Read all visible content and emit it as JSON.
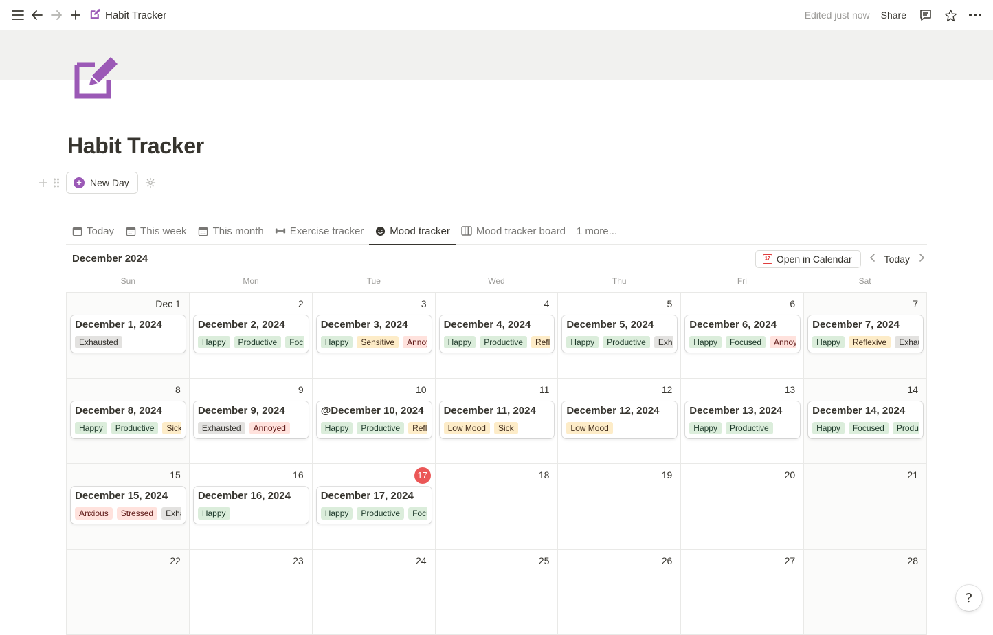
{
  "topbar": {
    "title": "Habit Tracker",
    "edited": "Edited just now",
    "share": "Share"
  },
  "page": {
    "title": "Habit Tracker",
    "new_day": "New Day",
    "icon_color": "#9b59b6"
  },
  "tabs": [
    {
      "label": "Today",
      "icon": "calendar-icon"
    },
    {
      "label": "This week",
      "icon": "calendar-grid-icon"
    },
    {
      "label": "This month",
      "icon": "calendar-grid-icon"
    },
    {
      "label": "Exercise tracker",
      "icon": "dumbbell-icon"
    },
    {
      "label": "Mood tracker",
      "icon": "smiley-icon",
      "active": true
    },
    {
      "label": "Mood tracker board",
      "icon": "board-icon"
    },
    {
      "label": "1 more...",
      "icon": ""
    }
  ],
  "calendar": {
    "month": "December 2024",
    "open_in_calendar": "Open in Calendar",
    "today": "Today",
    "weekdays": [
      "Sun",
      "Mon",
      "Tue",
      "Wed",
      "Thu",
      "Fri",
      "Sat"
    ],
    "today_date": "17",
    "days": [
      {
        "num": "Dec 1",
        "title": "December 1, 2024",
        "tags": [
          [
            "Exhausted",
            "gray"
          ]
        ]
      },
      {
        "num": "2",
        "title": "December 2, 2024",
        "tags": [
          [
            "Happy",
            "green"
          ],
          [
            "Productive",
            "green"
          ],
          [
            "Focused",
            "green"
          ]
        ]
      },
      {
        "num": "3",
        "title": "December 3, 2024",
        "tags": [
          [
            "Happy",
            "green"
          ],
          [
            "Sensitive",
            "orange"
          ],
          [
            "Annoyed",
            "red"
          ]
        ]
      },
      {
        "num": "4",
        "title": "December 4, 2024",
        "tags": [
          [
            "Happy",
            "green"
          ],
          [
            "Productive",
            "green"
          ],
          [
            "Reflexive",
            "orange"
          ]
        ]
      },
      {
        "num": "5",
        "title": "December 5, 2024",
        "tags": [
          [
            "Happy",
            "green"
          ],
          [
            "Productive",
            "green"
          ],
          [
            "Exhausted",
            "gray"
          ]
        ]
      },
      {
        "num": "6",
        "title": "December 6, 2024",
        "tags": [
          [
            "Happy",
            "green"
          ],
          [
            "Focused",
            "green"
          ],
          [
            "Annoyed",
            "red"
          ]
        ]
      },
      {
        "num": "7",
        "title": "December 7, 2024",
        "tags": [
          [
            "Happy",
            "green"
          ],
          [
            "Reflexive",
            "orange"
          ],
          [
            "Exhausted",
            "gray"
          ]
        ]
      },
      {
        "num": "8",
        "title": "December 8, 2024",
        "tags": [
          [
            "Happy",
            "green"
          ],
          [
            "Productive",
            "green"
          ],
          [
            "Sick",
            "orange"
          ]
        ]
      },
      {
        "num": "9",
        "title": "December 9, 2024",
        "tags": [
          [
            "Exhausted",
            "gray"
          ],
          [
            "Annoyed",
            "red"
          ]
        ]
      },
      {
        "num": "10",
        "title": "@December 10, 2024",
        "tags": [
          [
            "Happy",
            "green"
          ],
          [
            "Productive",
            "green"
          ],
          [
            "Reflexive",
            "orange"
          ]
        ]
      },
      {
        "num": "11",
        "title": "December 11, 2024",
        "tags": [
          [
            "Low Mood",
            "orange"
          ],
          [
            "Sick",
            "orange"
          ]
        ]
      },
      {
        "num": "12",
        "title": "December 12, 2024",
        "tags": [
          [
            "Low Mood",
            "orange"
          ]
        ]
      },
      {
        "num": "13",
        "title": "December 13, 2024",
        "tags": [
          [
            "Happy",
            "green"
          ],
          [
            "Productive",
            "green"
          ]
        ]
      },
      {
        "num": "14",
        "title": "December 14, 2024",
        "tags": [
          [
            "Happy",
            "green"
          ],
          [
            "Focused",
            "green"
          ],
          [
            "Productive",
            "green"
          ]
        ]
      },
      {
        "num": "15",
        "title": "December 15, 2024",
        "tags": [
          [
            "Anxious",
            "red"
          ],
          [
            "Stressed",
            "red"
          ],
          [
            "Exhausted",
            "gray"
          ]
        ]
      },
      {
        "num": "16",
        "title": "December 16, 2024",
        "tags": [
          [
            "Happy",
            "green"
          ]
        ]
      },
      {
        "num": "17",
        "title": "December 17, 2024",
        "tags": [
          [
            "Happy",
            "green"
          ],
          [
            "Productive",
            "green"
          ],
          [
            "Focused",
            "green"
          ]
        ]
      },
      {
        "num": "18"
      },
      {
        "num": "19"
      },
      {
        "num": "20"
      },
      {
        "num": "21"
      },
      {
        "num": "22"
      },
      {
        "num": "23"
      },
      {
        "num": "24"
      },
      {
        "num": "25"
      },
      {
        "num": "26"
      },
      {
        "num": "27"
      },
      {
        "num": "28"
      }
    ]
  },
  "help": "?"
}
